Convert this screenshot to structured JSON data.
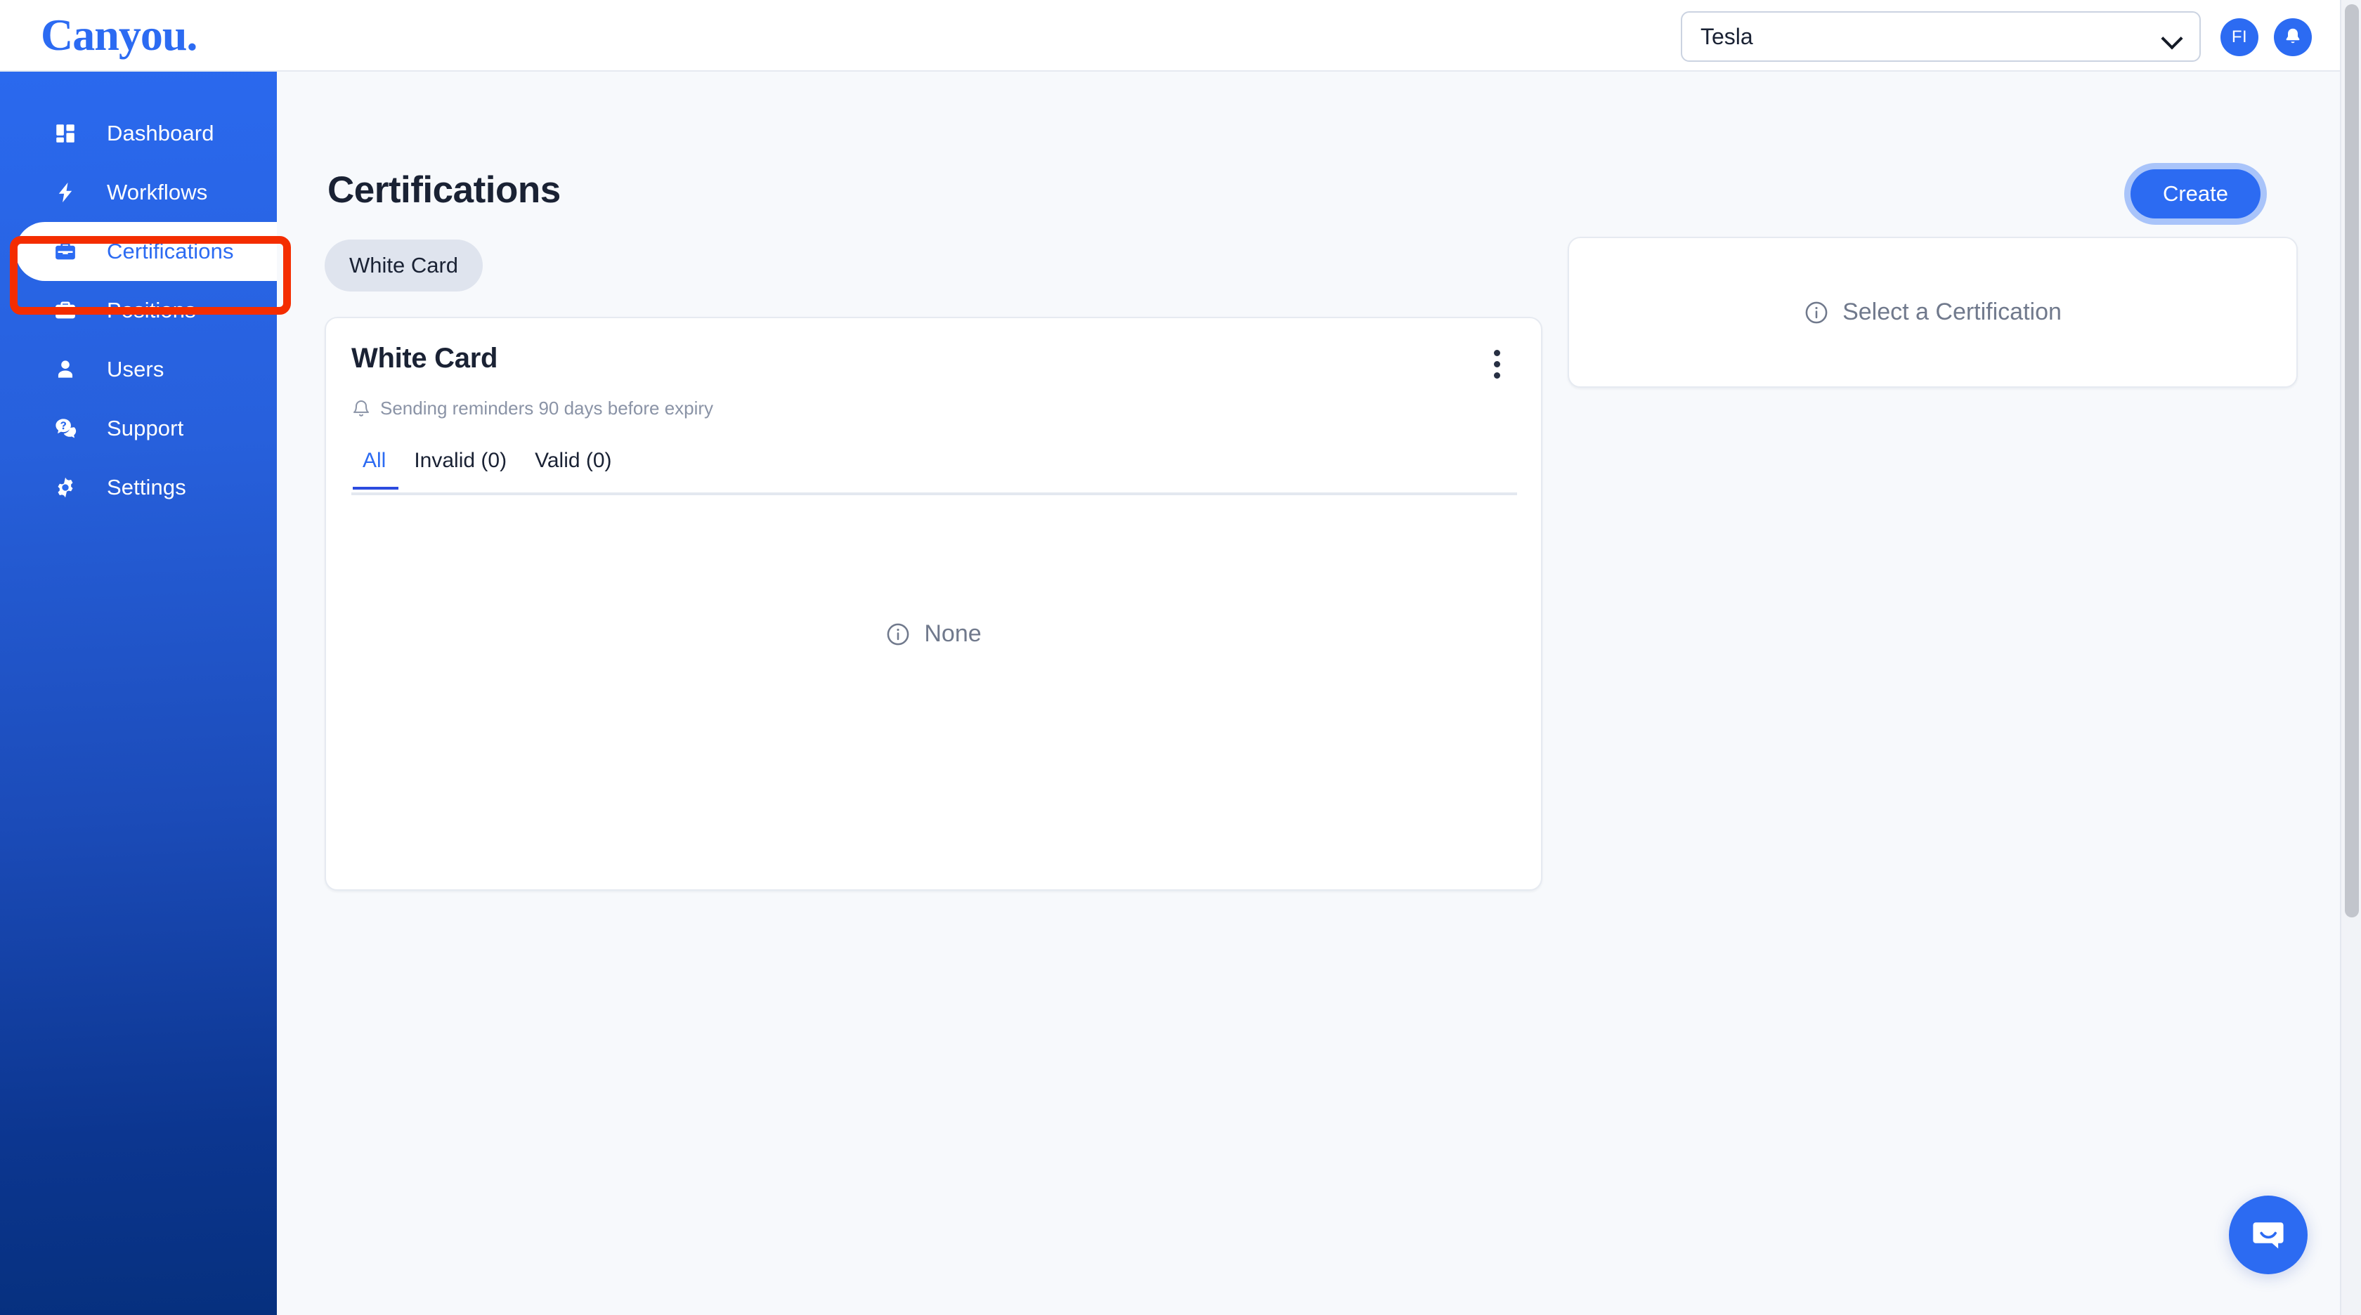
{
  "brand": {
    "logo_text": "Canyou.",
    "accent_color": "#2C6BF2",
    "sidebar_gradient_top": "#2A69EE",
    "sidebar_gradient_bottom": "#06307E",
    "annotation_color": "#F42D00"
  },
  "topbar": {
    "org_selector": {
      "value": "Tesla",
      "placeholder": "Select organisation"
    },
    "avatar_initials": "FI",
    "notifications_icon": "bell-icon"
  },
  "sidebar": {
    "items": [
      {
        "label": "Dashboard",
        "icon": "dashboard-grid-icon",
        "active": false
      },
      {
        "label": "Workflows",
        "icon": "lightning-bolt-icon",
        "active": false
      },
      {
        "label": "Certifications",
        "icon": "briefcase-icon",
        "active": true
      },
      {
        "label": "Positions",
        "icon": "briefcase-icon",
        "active": false
      },
      {
        "label": "Users",
        "icon": "user-icon",
        "active": false
      },
      {
        "label": "Support",
        "icon": "chat-question-icon",
        "active": false
      },
      {
        "label": "Settings",
        "icon": "gear-icon",
        "active": false
      }
    ],
    "highlighted_item": "Positions"
  },
  "main": {
    "page_title": "Certifications",
    "create_label": "Create",
    "filter_chips": [
      {
        "label": "White Card"
      }
    ],
    "card": {
      "title": "White Card",
      "reminder_icon": "bell-icon",
      "reminder_text": "Sending reminders 90 days before expiry",
      "menu_icon": "kebab-menu-icon",
      "tabs": [
        {
          "label": "All",
          "active": true
        },
        {
          "label": "Invalid (0)",
          "active": false
        },
        {
          "label": "Valid (0)",
          "active": false
        }
      ],
      "empty_icon": "info-circle-icon",
      "empty_text": "None"
    },
    "detail_panel": {
      "icon": "info-circle-icon",
      "text": "Select a Certification"
    }
  },
  "widgets": {
    "intercom_icon": "chat-bubble-icon"
  }
}
